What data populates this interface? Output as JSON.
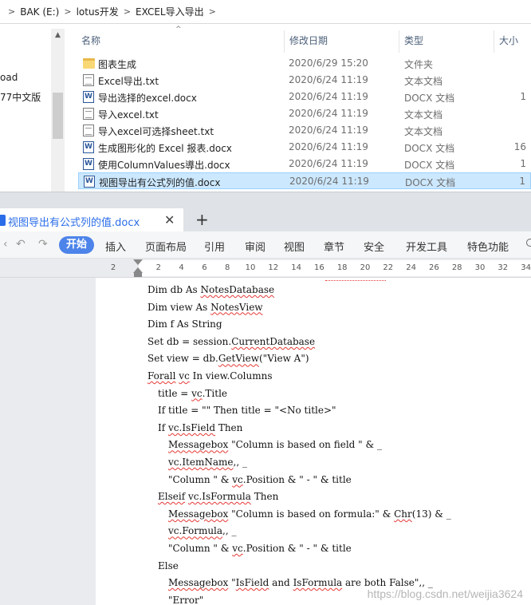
{
  "explorer": {
    "breadcrumb": [
      "BAK (E:)",
      "lotus开发",
      "EXCEL导入导出"
    ],
    "nav_items": [
      "oad",
      "77中文版"
    ],
    "columns": {
      "name": "名称",
      "date": "修改日期",
      "type": "类型",
      "size": "大小"
    },
    "files": [
      {
        "name": "图表生成",
        "date": "2020/6/29 15:20",
        "type": "文件夹",
        "size": "",
        "icon": "folder-icon"
      },
      {
        "name": "Excel导出.txt",
        "date": "2020/6/24 11:19",
        "type": "文本文档",
        "size": "",
        "icon": "text-file-icon"
      },
      {
        "name": "导出选择的excel.docx",
        "date": "2020/6/24 11:19",
        "type": "DOCX 文档",
        "size": "1",
        "icon": "word-doc-icon"
      },
      {
        "name": "导入excel.txt",
        "date": "2020/6/24 11:19",
        "type": "文本文档",
        "size": "",
        "icon": "text-file-icon"
      },
      {
        "name": "导入excel可选择sheet.txt",
        "date": "2020/6/24 11:19",
        "type": "文本文档",
        "size": "",
        "icon": "text-file-icon"
      },
      {
        "name": "生成图形化的 Excel 报表.docx",
        "date": "2020/6/24 11:19",
        "type": "DOCX 文档",
        "size": "16",
        "icon": "word-doc-icon"
      },
      {
        "name": "使用ColumnValues導出.docx",
        "date": "2020/6/24 11:19",
        "type": "DOCX 文档",
        "size": "1",
        "icon": "word-doc-icon"
      },
      {
        "name": "视图导出有公式列的值.docx",
        "date": "2020/6/24 11:19",
        "type": "DOCX 文档",
        "size": "1",
        "icon": "word-doc-icon",
        "selected": true
      }
    ]
  },
  "wps": {
    "tab_title": "视图导出有公式列的值.docx",
    "new_tab": "+",
    "close": "✕",
    "ribbon_tabs": [
      "开始",
      "插入",
      "页面布局",
      "引用",
      "审阅",
      "视图",
      "章节",
      "安全",
      "开发工具",
      "特色功能"
    ],
    "ruler_ticks": [
      "2",
      "2",
      "4",
      "6",
      "8",
      "10",
      "12",
      "14",
      "16",
      "18",
      "20",
      "22",
      "24",
      "26",
      "28",
      "30",
      "32",
      "34"
    ],
    "code_lines": [
      {
        "indent": 0,
        "segments": [
          [
            "Dim db As ",
            false
          ],
          [
            "NotesDatabase",
            true
          ]
        ]
      },
      {
        "indent": 0,
        "segments": [
          [
            "Dim view As ",
            false
          ],
          [
            "NotesView",
            true
          ]
        ]
      },
      {
        "indent": 0,
        "segments": [
          [
            "Dim f As String",
            false
          ]
        ]
      },
      {
        "indent": 0,
        "segments": [
          [
            "Set db = session.",
            false
          ],
          [
            "CurrentDatabase",
            true
          ]
        ]
      },
      {
        "indent": 0,
        "segments": [
          [
            "Set view = db.",
            false
          ],
          [
            "GetView",
            true
          ],
          [
            "(\"View A\")",
            false
          ]
        ]
      },
      {
        "indent": 0,
        "segments": [
          [
            "Forall",
            true
          ],
          [
            " ",
            false
          ],
          [
            "vc",
            true
          ],
          [
            " In view.Columns",
            false
          ]
        ]
      },
      {
        "indent": 1,
        "segments": [
          [
            "title = ",
            false
          ],
          [
            "vc",
            true
          ],
          [
            ".Title",
            false
          ]
        ]
      },
      {
        "indent": 1,
        "segments": [
          [
            "If title = \"\" Then title = \"<No title>\"",
            false
          ]
        ]
      },
      {
        "indent": 1,
        "segments": [
          [
            "If ",
            false
          ],
          [
            "vc.IsField",
            true
          ],
          [
            " Then",
            false
          ]
        ]
      },
      {
        "indent": 2,
        "segments": [
          [
            "Messagebox",
            true
          ],
          [
            " \"Column is based on field \" & _",
            false
          ]
        ]
      },
      {
        "indent": 2,
        "segments": [
          [
            "vc.ItemName",
            true
          ],
          [
            ",, _",
            false
          ]
        ]
      },
      {
        "indent": 2,
        "segments": [
          [
            "\"Column \" & ",
            false
          ],
          [
            "vc",
            true
          ],
          [
            ".Position & \" - \" & title",
            false
          ]
        ]
      },
      {
        "indent": 1,
        "segments": [
          [
            "Elseif",
            true
          ],
          [
            " ",
            false
          ],
          [
            "vc.IsFormula",
            true
          ],
          [
            " Then",
            false
          ]
        ]
      },
      {
        "indent": 2,
        "segments": [
          [
            "Messagebox",
            true
          ],
          [
            " \"Column is based on formula:\" & ",
            false
          ],
          [
            "Chr",
            true
          ],
          [
            "(13) & _",
            false
          ]
        ]
      },
      {
        "indent": 2,
        "segments": [
          [
            "vc.Formula",
            true
          ],
          [
            ",, _",
            false
          ]
        ]
      },
      {
        "indent": 2,
        "segments": [
          [
            "\"Column \" & ",
            false
          ],
          [
            "vc",
            true
          ],
          [
            ".Position & \" - \" & title",
            false
          ]
        ]
      },
      {
        "indent": 1,
        "segments": [
          [
            "Else",
            false
          ]
        ]
      },
      {
        "indent": 2,
        "segments": [
          [
            "Messagebox",
            true
          ],
          [
            " \"",
            false
          ],
          [
            "IsField",
            true
          ],
          [
            " and ",
            false
          ],
          [
            "IsFormula",
            true
          ],
          [
            " are both False\",, _",
            false
          ]
        ]
      },
      {
        "indent": 2,
        "segments": [
          [
            "\"Error\"",
            false
          ]
        ]
      }
    ],
    "watermark": "https://blog.csdn.net/weijia3624"
  }
}
